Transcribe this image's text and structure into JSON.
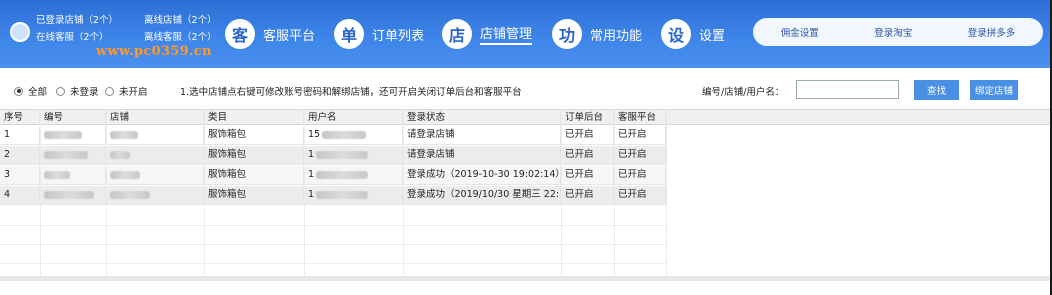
{
  "header": {
    "stats": [
      [
        "已登录店铺（2个）",
        "离线店铺（2个）"
      ],
      [
        "在线客服（2个）",
        "离线客服（2个）"
      ]
    ],
    "watermark": "www.pc0359.cn",
    "nav": [
      {
        "icon_char": "客",
        "label": "客服平台"
      },
      {
        "icon_char": "单",
        "label": "订单列表"
      },
      {
        "icon_char": "店",
        "label": "店铺管理"
      },
      {
        "icon_char": "功",
        "label": "常用功能"
      },
      {
        "icon_char": "设",
        "label": "设置"
      }
    ],
    "pills": [
      "佣金设置",
      "登录淘宝",
      "登录拼多多"
    ]
  },
  "filter": {
    "radios": [
      "全部",
      "未登录",
      "未开启"
    ],
    "selected": "全部",
    "hint": "1.选中店铺点右键可修改账号密码和解绑店铺，还可开启关闭订单后台和客服平台",
    "search_label": "编号/店铺/用户名：",
    "search_value": "",
    "search_button": "查找",
    "bind_button": "绑定店铺"
  },
  "table": {
    "columns": [
      "序号",
      "编号",
      "店铺",
      "类目",
      "用户名",
      "登录状态",
      "订单后台",
      "客服平台"
    ],
    "rows": [
      {
        "idx": "1",
        "category": "服饰箱包",
        "user_prefix": "15",
        "status": "请登录店铺",
        "order": "已开启",
        "service": "已开启"
      },
      {
        "idx": "2",
        "category": "服饰箱包",
        "user_prefix": "1",
        "status": "请登录店铺",
        "order": "已开启",
        "service": "已开启"
      },
      {
        "idx": "3",
        "category": "服饰箱包",
        "user_prefix": "1",
        "status": "登录成功（2019-10-30 19:02:14）",
        "order": "已开启",
        "service": "已开启"
      },
      {
        "idx": "4",
        "category": "服饰箱包",
        "user_prefix": "1",
        "status": "登录成功（2019/10/30 星期三 22:…",
        "order": "已开启",
        "service": "已开启"
      }
    ]
  },
  "colors": {
    "header_blue": "#3f86ea",
    "button_blue": "#4a8fe6"
  }
}
